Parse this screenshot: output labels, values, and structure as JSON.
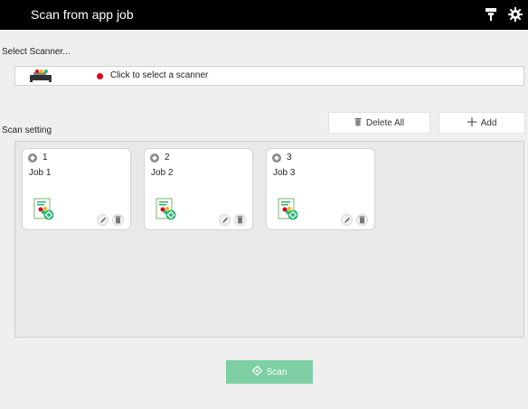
{
  "app": {
    "title": "Scan from app job"
  },
  "icons": {
    "scanner_status": "scanner-status-icon",
    "settings": "gear-icon",
    "scanner": "scanner-icon",
    "delete": "trash-icon",
    "add": "plus-icon",
    "edit": "pencil-icon",
    "scan": "scan-diamond-icon"
  },
  "scanner": {
    "section_label": "Select Scanner...",
    "placeholder": "Click to select a scanner",
    "status_color": "#e0001b"
  },
  "scan_setting": {
    "section_label": "Scan setting",
    "delete_all_label": "Delete All",
    "add_label": "Add",
    "jobs": [
      {
        "number": "1",
        "name": "Job 1"
      },
      {
        "number": "2",
        "name": "Job 2"
      },
      {
        "number": "3",
        "name": "Job 3"
      }
    ]
  },
  "actions": {
    "scan_label": "Scan"
  },
  "colors": {
    "titlebar": "#000000",
    "scan_button": "#7fcfa4",
    "accent_green": "#2bb673"
  }
}
